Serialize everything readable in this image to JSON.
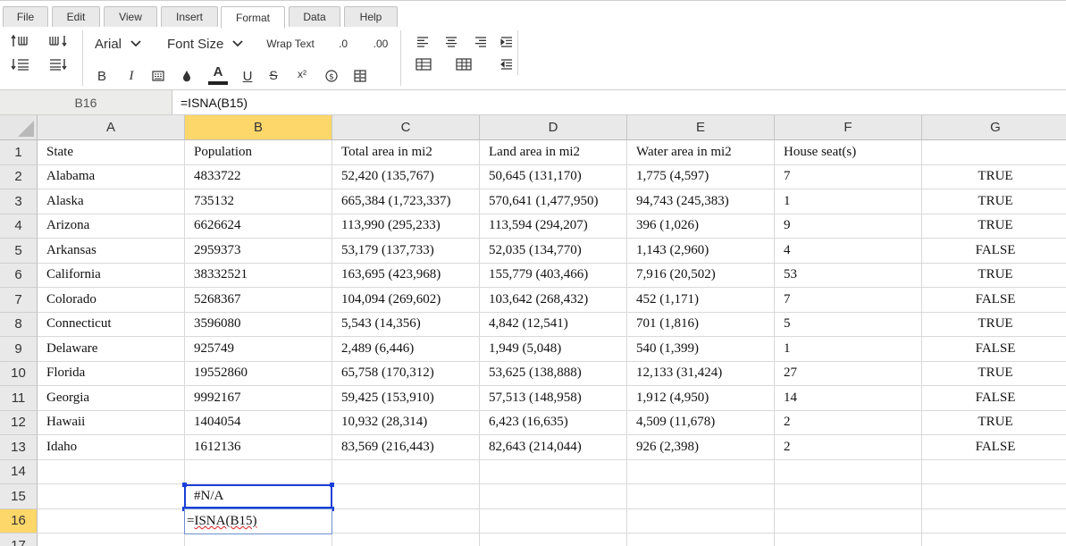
{
  "menu": {
    "tabs": [
      "File",
      "Edit",
      "View",
      "Insert",
      "Format",
      "Data",
      "Help"
    ],
    "active_tab": "Format"
  },
  "toolbar": {
    "font_name": "Arial",
    "font_size_label": "Font Size",
    "wrap_text_label": "Wrap Text",
    "decrease_decimal_label": ".0",
    "increase_decimal_label": ".00",
    "bold_label": "B",
    "italic_label": "I",
    "font_color_label": "A",
    "underline_label": "U",
    "strikethrough_label": "S",
    "superscript_label": "x²",
    "icons": [
      "sort-asc-icon",
      "sort-desc-icon",
      "indent-icon",
      "outdent-icon",
      "chevron-down-icon",
      "cell-style-icon",
      "fill-color-icon",
      "currency-icon",
      "merge-icon",
      "align-left-icon",
      "align-center-icon",
      "align-right-icon",
      "indent-right-icon",
      "table-icon",
      "borders-icon"
    ]
  },
  "formula_bar": {
    "cell_ref": "B16",
    "formula": "=ISNA(B15)"
  },
  "sheet": {
    "columns": [
      "A",
      "B",
      "C",
      "D",
      "E",
      "F",
      "G"
    ],
    "selected_column": "B",
    "selected_row": "16",
    "row_numbers": [
      "1",
      "2",
      "3",
      "4",
      "5",
      "6",
      "7",
      "8",
      "9",
      "10",
      "11",
      "12",
      "13",
      "14",
      "15",
      "16",
      "17"
    ],
    "rows": [
      [
        "State",
        "Population",
        "Total area in mi2",
        "Land area in mi2",
        "Water area in mi2",
        "House seat(s)",
        ""
      ],
      [
        "Alabama",
        "4833722",
        "52,420 (135,767)",
        "50,645 (131,170)",
        "1,775 (4,597)",
        "7",
        "TRUE"
      ],
      [
        "Alaska",
        "735132",
        "665,384 (1,723,337)",
        "570,641 (1,477,950)",
        "94,743 (245,383)",
        "1",
        "TRUE"
      ],
      [
        "Arizona",
        "6626624",
        "113,990 (295,233)",
        "113,594 (294,207)",
        "396 (1,026)",
        "9",
        "TRUE"
      ],
      [
        "Arkansas",
        "2959373",
        "53,179 (137,733)",
        "52,035 (134,770)",
        "1,143 (2,960)",
        "4",
        "FALSE"
      ],
      [
        "California",
        "38332521",
        "163,695 (423,968)",
        "155,779 (403,466)",
        "7,916 (20,502)",
        "53",
        "TRUE"
      ],
      [
        "Colorado",
        "5268367",
        "104,094 (269,602)",
        "103,642 (268,432)",
        "452 (1,171)",
        "7",
        "FALSE"
      ],
      [
        "Connecticut",
        "3596080",
        "5,543 (14,356)",
        "4,842 (12,541)",
        "701 (1,816)",
        "5",
        "TRUE"
      ],
      [
        "Delaware",
        "925749",
        "2,489 (6,446)",
        "1,949 (5,048)",
        "540 (1,399)",
        "1",
        "FALSE"
      ],
      [
        "Florida",
        "19552860",
        "65,758 (170,312)",
        "53,625 (138,888)",
        "12,133 (31,424)",
        "27",
        "TRUE"
      ],
      [
        "Georgia",
        "9992167",
        "59,425 (153,910)",
        "57,513 (148,958)",
        "1,912 (4,950)",
        "14",
        "FALSE"
      ],
      [
        "Hawaii",
        "1404054",
        "10,932 (28,314)",
        "6,423 (16,635)",
        "4,509 (11,678)",
        "2",
        "TRUE"
      ],
      [
        "Idaho",
        "1612136",
        "83,569 (216,443)",
        "82,643 (214,044)",
        "926 (2,398)",
        "2",
        "FALSE"
      ],
      [
        "",
        "",
        "",
        "",
        "",
        "",
        ""
      ],
      [
        "",
        "#N/A",
        "",
        "",
        "",
        "",
        ""
      ],
      [
        "",
        "",
        "",
        "",
        "",
        "",
        ""
      ],
      [
        "",
        "",
        "",
        "",
        "",
        "",
        ""
      ]
    ],
    "editor": {
      "prefix": "=",
      "text": "ISNA(B15)"
    }
  },
  "colors": {
    "selection_border": "#1a3fd8",
    "header_highlight": "#fdd76a",
    "header_bg": "#e9e9e9"
  }
}
